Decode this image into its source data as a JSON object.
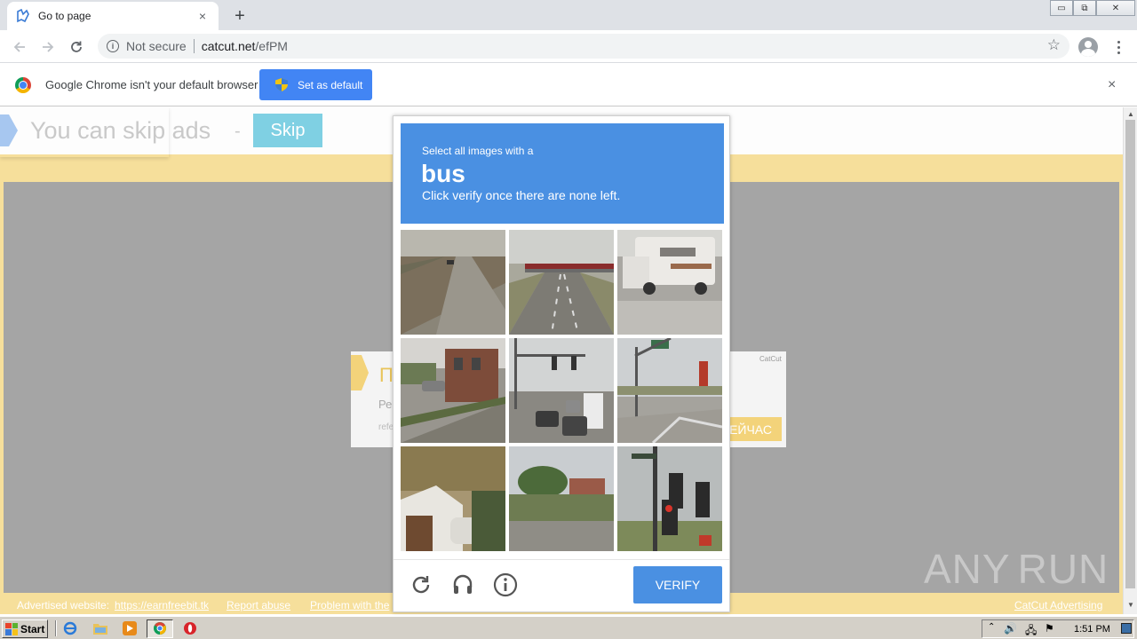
{
  "browser": {
    "tab_title": "Go to page",
    "tab_close": "×",
    "new_tab": "+",
    "not_secure": "Not secure",
    "url_domain": "catcut.net",
    "url_path": "/efPM",
    "infobar_text": "Google Chrome isn't your default browser",
    "set_default_label": "Set as default",
    "infobar_close": "×",
    "window_controls": [
      "▭",
      "⧉",
      "✕"
    ]
  },
  "page": {
    "skip_text": "You can skip ads",
    "skip_dash": "-",
    "skip_button": "Skip",
    "ad_title": "П",
    "ad_subtitle": "Ре",
    "ad_ref": "refe",
    "ad_badge": "CatCut",
    "ad_button": "ЕЙЧАС",
    "footer": {
      "advertised_label": "Advertised website:",
      "advertised_link": "https://earnfreebit.tk",
      "report": "Report abuse",
      "problem": "Problem with the",
      "catcut_ad": "CatCut Advertising"
    }
  },
  "captcha": {
    "prompt_pre": "Select all images with a",
    "target": "bus",
    "prompt_post": "Click verify once there are none left.",
    "verify_label": "VERIFY",
    "tiles": [
      {
        "id": 1,
        "scene": "road"
      },
      {
        "id": 2,
        "scene": "highway-bridge"
      },
      {
        "id": 3,
        "scene": "rv-truck"
      },
      {
        "id": 4,
        "scene": "street-buildings"
      },
      {
        "id": 5,
        "scene": "intersection-traffic"
      },
      {
        "id": 6,
        "scene": "street-signs"
      },
      {
        "id": 7,
        "scene": "house"
      },
      {
        "id": 8,
        "scene": "field-trees"
      },
      {
        "id": 9,
        "scene": "traffic-light"
      }
    ],
    "icons": [
      "reload-icon",
      "audio-icon",
      "info-icon"
    ]
  },
  "watermark": {
    "left": "ANY",
    "right": "RUN"
  },
  "taskbar": {
    "start": "Start",
    "time": "1:51 PM"
  },
  "colors": {
    "captcha_blue": "#4a90e2",
    "page_yellow": "#f6df9b",
    "chrome_blue": "#4285f4",
    "skip_cyan": "#7fd0e3"
  }
}
